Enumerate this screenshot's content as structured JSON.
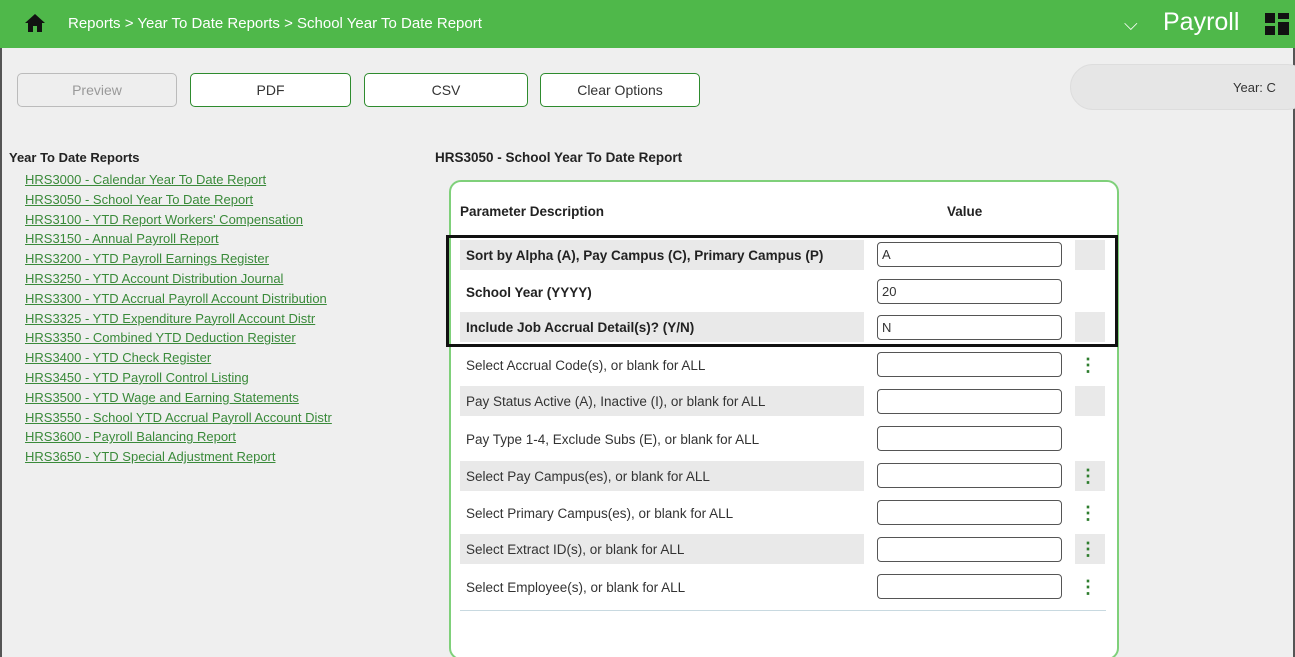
{
  "header": {
    "breadcrumb": "Reports > Year To Date Reports > School Year To Date Report",
    "app_title": "Payroll",
    "icons": {
      "home": "home-icon",
      "chevron": "chevron-down-icon",
      "grid": "app-grid-icon"
    }
  },
  "toolbar": {
    "preview_label": "Preview",
    "pdf_label": "PDF",
    "csv_label": "CSV",
    "clear_label": "Clear Options",
    "year_label": "Year: C"
  },
  "nav": {
    "title": "Year To Date Reports",
    "items": [
      "HRS3000 - Calendar Year To Date Report",
      "HRS3050 - School Year To Date Report",
      "HRS3100 - YTD Report Workers' Compensation",
      "HRS3150 - Annual Payroll Report",
      "HRS3200 - YTD Payroll Earnings Register",
      "HRS3250 - YTD Account Distribution Journal",
      "HRS3300 - YTD Accrual Payroll Account Distribution",
      "HRS3325 - YTD Expenditure Payroll Account Distr",
      "HRS3350 - Combined YTD Deduction Register",
      "HRS3400 - YTD Check Register",
      "HRS3450 - YTD Payroll Control Listing",
      "HRS3500 - YTD Wage and Earning Statements",
      "HRS3550 - School YTD Accrual Payroll Account Distr",
      "HRS3600 - Payroll Balancing Report",
      "HRS3650 - YTD Special Adjustment Report"
    ]
  },
  "form": {
    "title": "HRS3050 - School Year To Date Report",
    "header_param": "Parameter Description",
    "header_value": "Value",
    "rows": [
      {
        "label": "Sort by Alpha (A), Pay Campus (C), Primary Campus (P)",
        "value": "A"
      },
      {
        "label": "School Year (YYYY)",
        "value": "20"
      },
      {
        "label": "Include Job Accrual Detail(s)? (Y/N)",
        "value": "N"
      },
      {
        "label": "Select Accrual Code(s), or blank for ALL",
        "value": ""
      },
      {
        "label": "Pay Status Active (A), Inactive (I), or blank for ALL",
        "value": ""
      },
      {
        "label": "Pay Type 1-4, Exclude Subs (E), or blank for ALL",
        "value": ""
      },
      {
        "label": "Select Pay Campus(es), or blank for ALL",
        "value": ""
      },
      {
        "label": "Select Primary Campus(es), or blank for ALL",
        "value": ""
      },
      {
        "label": "Select Extract ID(s), or blank for ALL",
        "value": ""
      },
      {
        "label": "Select Employee(s), or blank for ALL",
        "value": ""
      }
    ],
    "kebab_glyph": "⋮"
  },
  "colors": {
    "header_green": "#4fb84a",
    "link_green": "#3a8a3a",
    "panel_border": "#7fd07a"
  }
}
